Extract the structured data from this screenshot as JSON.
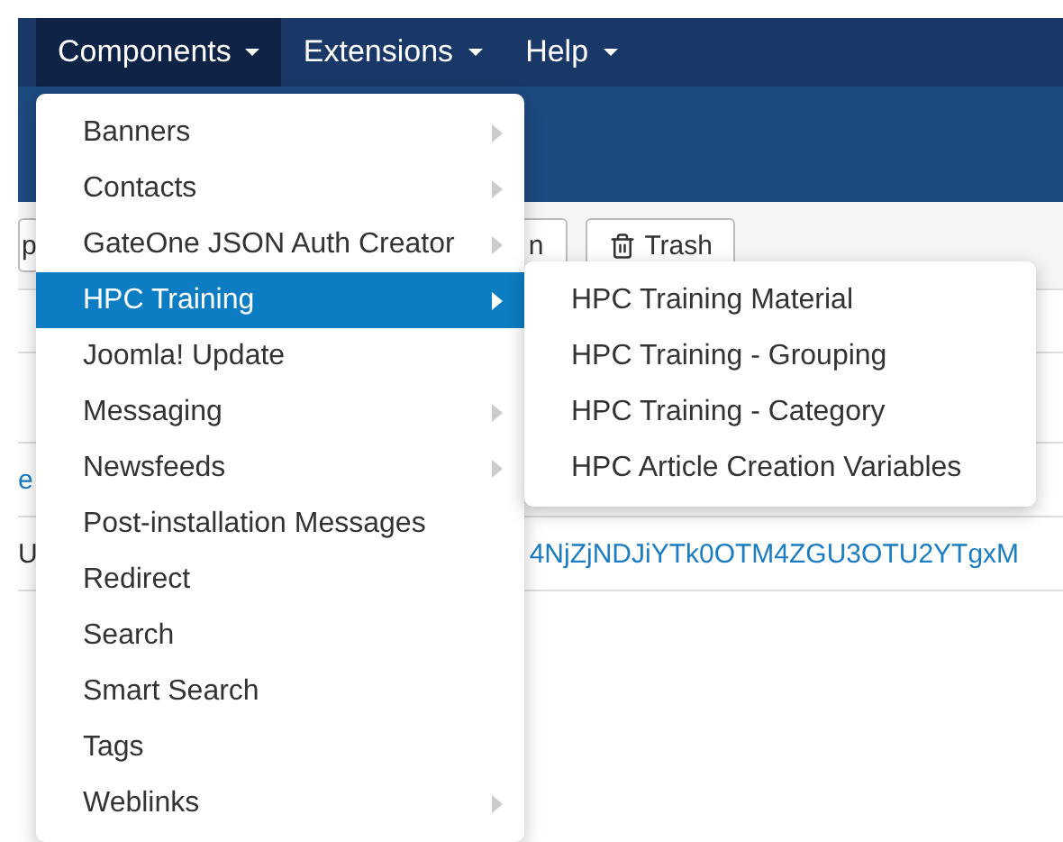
{
  "navbar": {
    "items": [
      {
        "label": "Components",
        "selected": true
      },
      {
        "label": "Extensions",
        "selected": false
      },
      {
        "label": "Help",
        "selected": false
      }
    ]
  },
  "toolbar": {
    "buttons": [
      {
        "label": "p",
        "kind": "text"
      },
      {
        "label": "n",
        "kind": "text"
      },
      {
        "label": "Trash",
        "kind": "trash"
      }
    ]
  },
  "table": {
    "rows": [
      {
        "cells": [
          {
            "text": "e",
            "kind": "link"
          }
        ]
      },
      {
        "cells": [
          {
            "text": "U",
            "kind": "text"
          },
          {
            "text": "4NjZjNDJiYTk0OTM4ZGU3OTU2YTgxM",
            "kind": "link"
          }
        ]
      }
    ]
  },
  "menu": {
    "items": [
      {
        "label": "Banners",
        "has_submenu": true,
        "selected": false
      },
      {
        "label": "Contacts",
        "has_submenu": true,
        "selected": false
      },
      {
        "label": "GateOne JSON Auth Creator",
        "has_submenu": true,
        "selected": false
      },
      {
        "label": "HPC Training",
        "has_submenu": true,
        "selected": true
      },
      {
        "label": "Joomla! Update",
        "has_submenu": false,
        "selected": false
      },
      {
        "label": "Messaging",
        "has_submenu": true,
        "selected": false
      },
      {
        "label": "Newsfeeds",
        "has_submenu": true,
        "selected": false
      },
      {
        "label": "Post-installation Messages",
        "has_submenu": false,
        "selected": false
      },
      {
        "label": "Redirect",
        "has_submenu": false,
        "selected": false
      },
      {
        "label": "Search",
        "has_submenu": false,
        "selected": false
      },
      {
        "label": "Smart Search",
        "has_submenu": false,
        "selected": false
      },
      {
        "label": "Tags",
        "has_submenu": false,
        "selected": false
      },
      {
        "label": "Weblinks",
        "has_submenu": true,
        "selected": false
      }
    ]
  },
  "submenu": {
    "items": [
      {
        "label": "HPC Training Material"
      },
      {
        "label": "HPC Training - Grouping"
      },
      {
        "label": "HPC Training - Category"
      },
      {
        "label": "HPC Article Creation Variables"
      }
    ]
  }
}
